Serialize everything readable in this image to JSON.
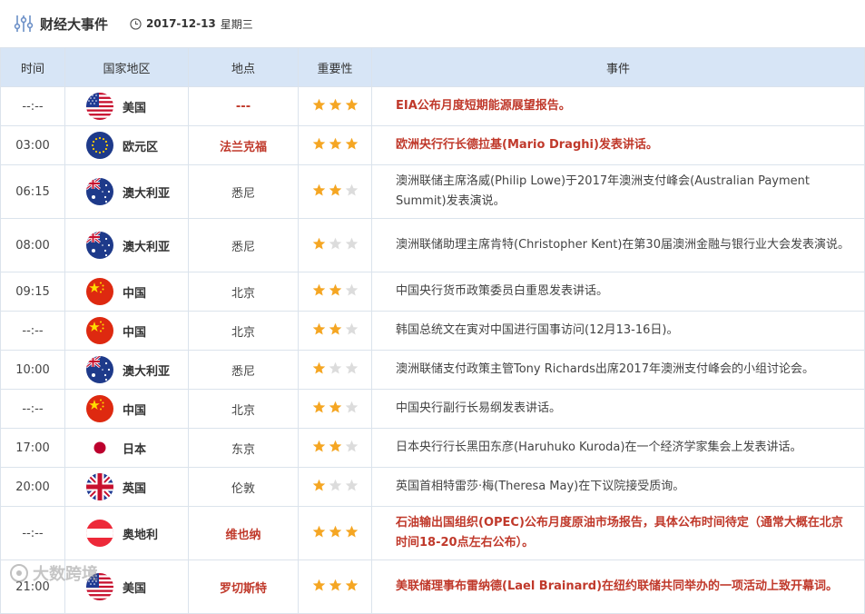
{
  "header": {
    "title": "财经大事件",
    "date": "2017-12-13",
    "weekday": "星期三"
  },
  "columns": [
    "时间",
    "国家地区",
    "地点",
    "重要性",
    "事件"
  ],
  "rows": [
    {
      "time": "--:--",
      "country": "美国",
      "flag": "us",
      "location": "---",
      "loc_red": true,
      "stars": 3,
      "event": "EIA公布月度短期能源展望报告。",
      "hot": true,
      "h": 1
    },
    {
      "time": "03:00",
      "country": "欧元区",
      "flag": "eu",
      "location": "法兰克福",
      "loc_red": true,
      "stars": 3,
      "event": "欧洲央行行长德拉基(Mario Draghi)发表讲话。",
      "hot": true,
      "h": 1
    },
    {
      "time": "06:15",
      "country": "澳大利亚",
      "flag": "au",
      "location": "悉尼",
      "loc_red": false,
      "stars": 2,
      "event": "澳洲联储主席洛威(Philip Lowe)于2017年澳洲支付峰会(Australian Payment Summit)发表演说。",
      "hot": false,
      "h": 2
    },
    {
      "time": "08:00",
      "country": "澳大利亚",
      "flag": "au",
      "location": "悉尼",
      "loc_red": false,
      "stars": 1,
      "event": "澳洲联储助理主席肯特(Christopher Kent)在第30届澳洲金融与银行业大会发表演说。",
      "hot": false,
      "h": 2
    },
    {
      "time": "09:15",
      "country": "中国",
      "flag": "cn",
      "location": "北京",
      "loc_red": false,
      "stars": 2,
      "event": "中国央行货币政策委员白重恩发表讲话。",
      "hot": false,
      "h": 1
    },
    {
      "time": "--:--",
      "country": "中国",
      "flag": "cn",
      "location": "北京",
      "loc_red": false,
      "stars": 2,
      "event": "韩国总统文在寅对中国进行国事访问(12月13-16日)。",
      "hot": false,
      "h": 1
    },
    {
      "time": "10:00",
      "country": "澳大利亚",
      "flag": "au",
      "location": "悉尼",
      "loc_red": false,
      "stars": 1,
      "event": "澳洲联储支付政策主管Tony Richards出席2017年澳洲支付峰会的小组讨论会。",
      "hot": false,
      "h": 1
    },
    {
      "time": "--:--",
      "country": "中国",
      "flag": "cn",
      "location": "北京",
      "loc_red": false,
      "stars": 2,
      "event": "中国央行副行长易纲发表讲话。",
      "hot": false,
      "h": 1
    },
    {
      "time": "17:00",
      "country": "日本",
      "flag": "jp",
      "location": "东京",
      "loc_red": false,
      "stars": 2,
      "event": "日本央行行长黑田东彦(Haruhuko Kuroda)在一个经济学家集会上发表讲话。",
      "hot": false,
      "h": 1
    },
    {
      "time": "20:00",
      "country": "英国",
      "flag": "gb",
      "location": "伦敦",
      "loc_red": false,
      "stars": 1,
      "event": "英国首相特雷莎·梅(Theresa May)在下议院接受质询。",
      "hot": false,
      "h": 1
    },
    {
      "time": "--:--",
      "country": "奥地利",
      "flag": "at",
      "location": "维也纳",
      "loc_red": true,
      "stars": 3,
      "event": "石油输出国组织(OPEC)公布月度原油市场报告，具体公布时间待定（通常大概在北京时间18-20点左右公布）。",
      "hot": true,
      "h": 2
    },
    {
      "time": "21:00",
      "country": "美国",
      "flag": "us",
      "location": "罗切斯特",
      "loc_red": true,
      "stars": 3,
      "event": "美联储理事布雷纳德(Lael Brainard)在纽约联储共同举办的一项活动上致开幕词。",
      "hot": true,
      "h": 3
    }
  ],
  "watermark": "大数跨境",
  "colors": {
    "header_bg": "#d7e5f6",
    "hot_text": "#c0392b",
    "star_on": "#f5a623",
    "star_off": "#dcdcdc"
  }
}
